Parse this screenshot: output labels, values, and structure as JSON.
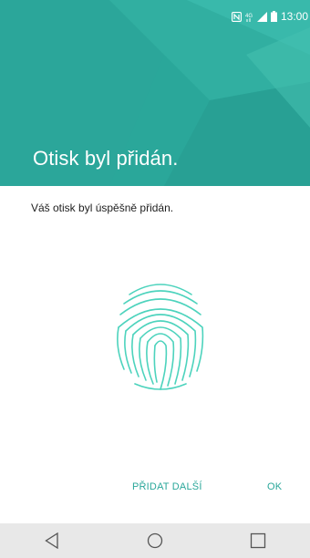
{
  "status_bar": {
    "time": "13:00",
    "icons": [
      "nfc-icon",
      "lte-icon",
      "signal-icon",
      "battery-icon"
    ]
  },
  "header": {
    "title": "Otisk byl přidán.",
    "color": "#2aa79a"
  },
  "content": {
    "message": "Váš otisk byl  úspěšně přidán.",
    "fingerprint_icon": "fingerprint-icon",
    "accent_color": "#4dd3bd"
  },
  "actions": {
    "add_another_label": "PŘIDAT DALŠÍ",
    "ok_label": "OK"
  },
  "nav_bar": {
    "back_icon": "back-triangle-icon",
    "home_icon": "home-circle-icon",
    "recents_icon": "recents-square-icon"
  }
}
